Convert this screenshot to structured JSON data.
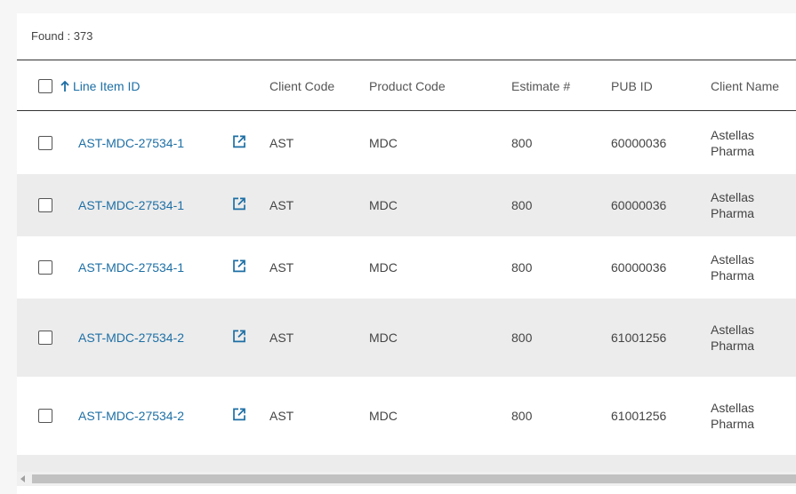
{
  "found_label": "Found : 373",
  "columns": {
    "line_item_id": "Line Item ID",
    "client_code": "Client Code",
    "product_code": "Product Code",
    "estimate": "Estimate #",
    "pub_id": "PUB ID",
    "client_name": "Client Name"
  },
  "rows": [
    {
      "line_item_id": "AST-MDC-27534-1",
      "client_code": "AST",
      "product_code": "MDC",
      "estimate": "800",
      "pub_id": "60000036",
      "client_name": "Astellas Pharma"
    },
    {
      "line_item_id": "AST-MDC-27534-1",
      "client_code": "AST",
      "product_code": "MDC",
      "estimate": "800",
      "pub_id": "60000036",
      "client_name": "Astellas Pharma"
    },
    {
      "line_item_id": "AST-MDC-27534-1",
      "client_code": "AST",
      "product_code": "MDC",
      "estimate": "800",
      "pub_id": "60000036",
      "client_name": "Astellas Pharma"
    },
    {
      "line_item_id": "AST-MDC-27534-2",
      "client_code": "AST",
      "product_code": "MDC",
      "estimate": "800",
      "pub_id": "61001256",
      "client_name": "Astellas Pharma"
    },
    {
      "line_item_id": "AST-MDC-27534-2",
      "client_code": "AST",
      "product_code": "MDC",
      "estimate": "800",
      "pub_id": "61001256",
      "client_name": "Astellas Pharma"
    }
  ],
  "icons": {
    "sort": "arrow-up-icon",
    "open": "external-link-icon"
  },
  "colors": {
    "link": "#1d6fa5",
    "alt_row": "#ececec"
  }
}
